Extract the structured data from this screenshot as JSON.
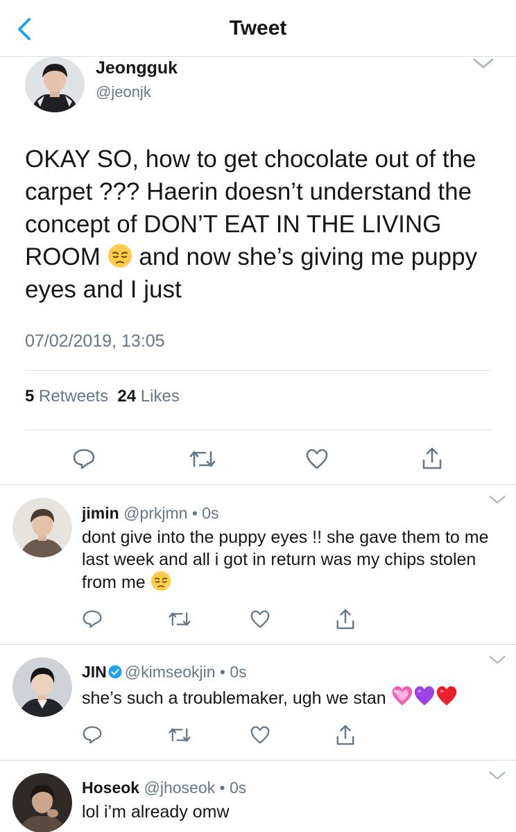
{
  "header": {
    "title": "Tweet"
  },
  "main_tweet": {
    "name": "Jeongguk",
    "handle": "@jeonjk",
    "text": "OKAY SO, how to get chocolate out of the carpet ??? Haerin doesn’t understand the concept of DON’T EAT IN THE LIVING ROOM",
    "text_after_emoji": " and now she’s giving me puppy eyes and I just",
    "emoji": "pensive-face",
    "timestamp": "07/02/2019, 13:05",
    "retweets_count": "5",
    "retweets_label": "Retweets",
    "likes_count": "24",
    "likes_label": "Likes"
  },
  "replies": [
    {
      "name": "jimin",
      "handle": "@prkjmn",
      "time": "0s",
      "text": "dont give into the puppy eyes !! she gave them to me last week and all i got in return was my chips stolen from me",
      "emoji": "pensive-face"
    },
    {
      "name": "JIN",
      "verified": true,
      "handle": "@kimseokjin",
      "time": "0s",
      "text": "she’s such a troublemaker, ugh we stan",
      "emojis": [
        "sparkling-pink-heart",
        "purple-heart",
        "red-heart"
      ]
    },
    {
      "name": "Hoseok",
      "handle": "@jhoseok",
      "time": "0s",
      "text": "lol i’m already omw"
    }
  ],
  "dot": "•",
  "colors": {
    "accent": "#1da1f2",
    "secondary": "#657786",
    "text": "#14171a",
    "divider": "#d8dde1"
  }
}
